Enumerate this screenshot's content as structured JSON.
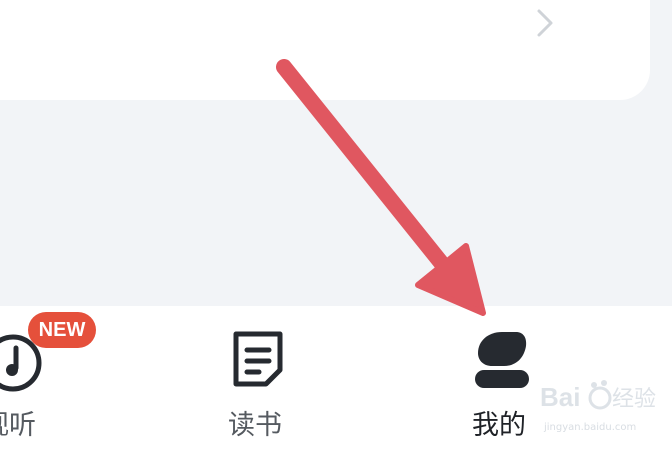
{
  "tabs": [
    {
      "label": "视听",
      "icon": "music-note-icon",
      "badge": "NEW",
      "active": false
    },
    {
      "label": "读书",
      "icon": "document-icon",
      "active": false
    },
    {
      "label": "我的",
      "icon": "person-icon",
      "active": true
    }
  ],
  "colors": {
    "background": "#f2f4f7",
    "card": "#ffffff",
    "inactive_text": "#555a60",
    "active_text": "#1f2227",
    "icon_dark": "#262a30",
    "badge": "#e5503b",
    "arrow": "#e05760",
    "chevron": "#cfd3d8"
  },
  "watermark": {
    "logo": "Baidu经验",
    "url": "jingyan.baidu.com"
  }
}
